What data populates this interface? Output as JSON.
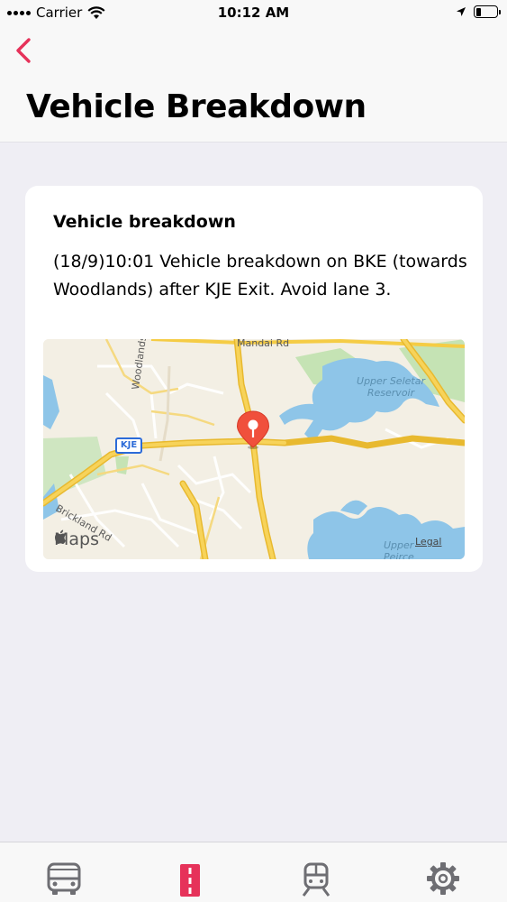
{
  "status_bar": {
    "carrier": "Carrier",
    "time": "10:12 AM"
  },
  "header": {
    "title": "Vehicle Breakdown",
    "back_icon": "chevron-left-icon"
  },
  "incident": {
    "title": "Vehicle breakdown",
    "message": "(18/9)10:01 Vehicle breakdown on BKE (towards Woodlands) after KJE Exit. Avoid lane 3."
  },
  "map": {
    "labels": {
      "mandai": "Mandai Rd",
      "woodlands": "Woodlands Rd",
      "reservoir": "Upper Seletar Reservoir",
      "kje": "KJE",
      "brickland": "Brickland Rd",
      "peirce": "Upper Peirce",
      "maps_brand": "Maps",
      "legal": "Legal"
    }
  },
  "tabs": [
    {
      "icon": "bus-icon",
      "active": false
    },
    {
      "icon": "road-icon",
      "active": true
    },
    {
      "icon": "train-icon",
      "active": false
    },
    {
      "icon": "gear-icon",
      "active": false
    }
  ],
  "colors": {
    "accent": "#e6325a",
    "road": "#f5cc45",
    "water": "#8ec5e8",
    "park": "#c5e3b4",
    "inactive_tab": "#6e6e73"
  }
}
